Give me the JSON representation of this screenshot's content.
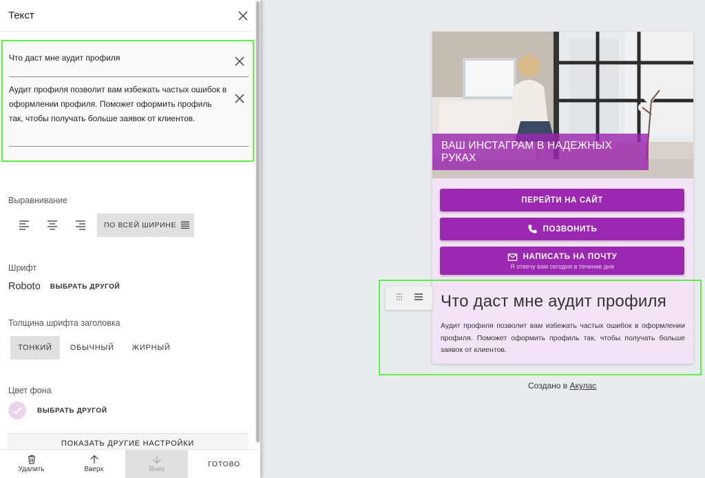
{
  "panel": {
    "title": "Текст",
    "heading_value": "Что даст мне аудит профиля",
    "body_value": "Аудит профиля позволит вам избежать частых ошибок в оформлении профиля. Поможет оформить профиль так, чтобы получать больше заявок от клиентов.",
    "alignment_label": "Выравнивание",
    "alignment_options": [
      "align-left",
      "align-center",
      "align-right"
    ],
    "alignment_justify_label": "ПО ВСЕЙ ШИРИНЕ",
    "font_label": "Шрифт",
    "font_name": "Roboto",
    "font_change": "ВЫБРАТЬ ДРУГОЙ",
    "weight_label": "Толщина шрифта заголовка",
    "weights": [
      "ТОНКИЙ",
      "ОБЫЧНЫЙ",
      "ЖИРНЫЙ"
    ],
    "weight_selected": "ТОНКИЙ",
    "bg_label": "Цвет фона",
    "bg_color": "#ead3ef",
    "bg_change": "ВЫБРАТЬ ДРУГОЙ",
    "more_settings": "ПОКАЗАТЬ ДРУГИЕ НАСТРОЙКИ"
  },
  "bottom_bar": {
    "delete": "Удалить",
    "up": "Вверх",
    "down": "Вниз",
    "done": "ГОТОВО"
  },
  "preview": {
    "banner": "ВАШ ИНСТАГРАМ В НАДЕЖНЫХ РУКАХ",
    "buttons": [
      {
        "label": "ПЕРЕЙТИ НА САЙТ",
        "icon": "",
        "sub": ""
      },
      {
        "label": "ПОЗВОНИТЬ",
        "icon": "phone-icon",
        "sub": ""
      },
      {
        "label": "НАПИСАТЬ НА ПОЧТУ",
        "icon": "mail-icon",
        "sub": "Я отвечу вам сегодня в течение дня"
      }
    ],
    "text_heading": "Что даст мне аудит профиля",
    "text_body": "Аудит профиля позволит вам избежать частых ошибок в оформлении профиля. Поможет оформить профиль так, чтобы получать больше заявок от клиентов.",
    "accent": "#9c27b0",
    "card_bg": "#f3e3f6"
  },
  "footer": {
    "prefix": "Создано в ",
    "link": "Акулас"
  }
}
